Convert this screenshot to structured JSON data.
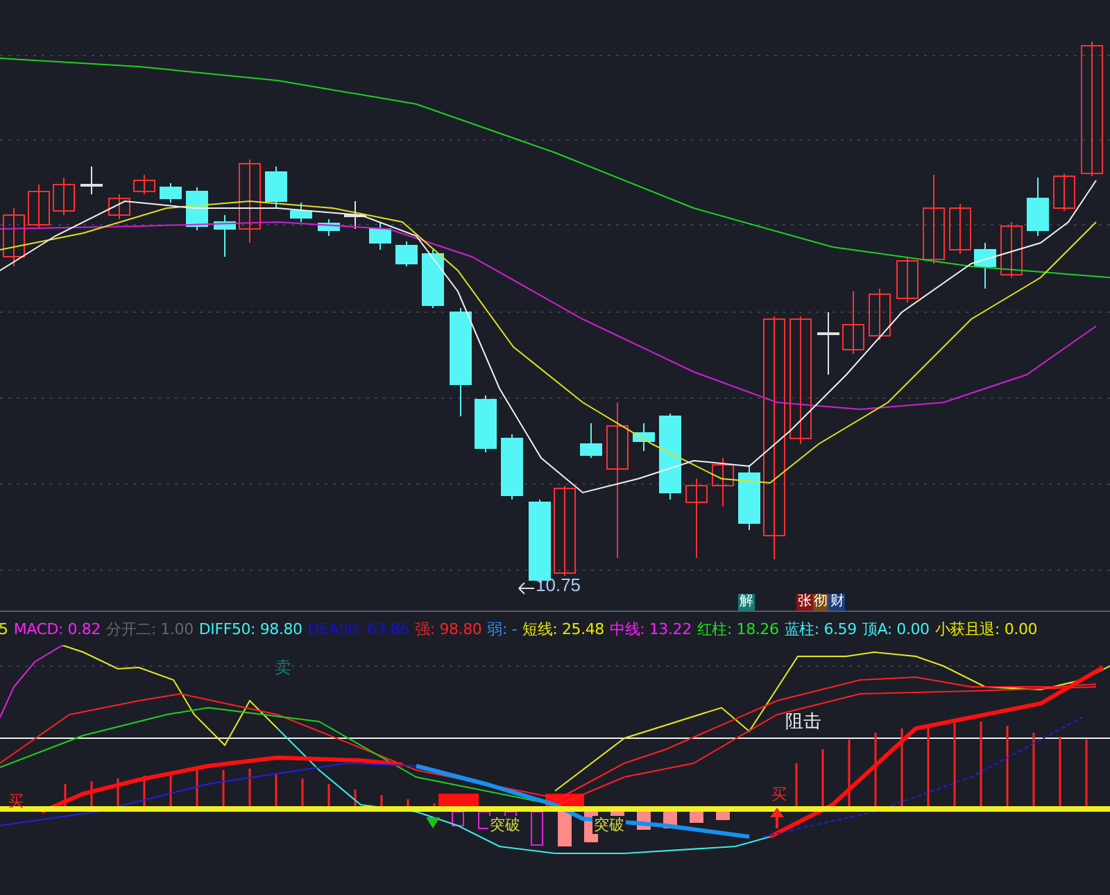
{
  "price_chart": {
    "low_label": "10.75"
  },
  "signal_badges": [
    {
      "text": "解",
      "color": "#167a78"
    },
    {
      "text": "张",
      "color": "#8a1414"
    },
    {
      "text": "彻",
      "color": "#7a4a10"
    },
    {
      "text": "财",
      "color": "#1a3f80"
    }
  ],
  "indicator": {
    "legend": [
      {
        "text": "5",
        "color": "#e8e800"
      },
      {
        "text": "MACD: 0.82",
        "color": "#ff20ff"
      },
      {
        "text": "分开二: 1.00",
        "color": "#686868"
      },
      {
        "text": "DIFF50: 98.80",
        "color": "#40f0f0"
      },
      {
        "text": "DEA50: 63.86",
        "color": "#1010e0"
      },
      {
        "text": "强: 98.80",
        "color": "#ff2020"
      },
      {
        "text": "弱: -",
        "color": "#3090ff"
      },
      {
        "text": "短线: 25.48",
        "color": "#e8e800"
      },
      {
        "text": "中线: 13.22",
        "color": "#ff20ff"
      },
      {
        "text": "红柱: 18.26",
        "color": "#20e020"
      },
      {
        "text": "蓝柱: 6.59",
        "color": "#40f0f0"
      },
      {
        "text": "顶A: 0.00",
        "color": "#40f0f0"
      },
      {
        "text": "小获且退: 0.00",
        "color": "#e8e800"
      }
    ],
    "marks": [
      {
        "text": "卖",
        "kind": "sell"
      },
      {
        "text": "阻击",
        "kind": "resist"
      },
      {
        "text": "买",
        "kind": "buy"
      },
      {
        "text": "突破",
        "kind": "break"
      },
      {
        "text": "突破",
        "kind": "break"
      },
      {
        "text": "买",
        "kind": "buy"
      }
    ]
  }
}
